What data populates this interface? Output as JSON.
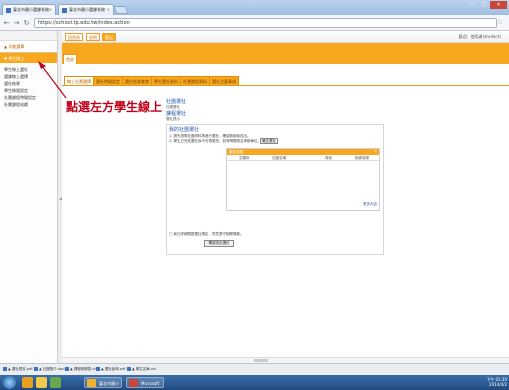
{
  "browser": {
    "tabs": [
      {
        "title": "臺北市國小選課系統"
      },
      {
        "title": "臺北市國小選課系統"
      }
    ],
    "url": "https://school.tp.edu.tw/index.action",
    "window_buttons": [
      "—",
      "□",
      "✕"
    ]
  },
  "sidebar": {
    "header": "▲ 功能選單",
    "active_item": "▼ 學生線上",
    "items": [
      "學生線上選社",
      "選課線上選擇",
      "選社結果",
      "學生帳號設定",
      "社團課程時間設定",
      "社團課程成績"
    ]
  },
  "topnav": {
    "buttons": [
      "回首頁",
      "說明",
      "登出"
    ],
    "user": "歡迎：使用者(student)"
  },
  "breadcrumb": "首頁",
  "content_tabs": [
    {
      "label": "線上社團選擇",
      "active": true
    },
    {
      "label": "選社時間設定",
      "active": false
    },
    {
      "label": "選社結果查詢",
      "active": false
    },
    {
      "label": "學生選社資料",
      "active": false
    },
    {
      "label": "社團課程資料",
      "active": false
    },
    {
      "label": "選社注意事項",
      "active": false
    }
  ],
  "annotation": "點選左方學生線上",
  "links": {
    "link1": "社團選社",
    "link1_sub": "社團選社",
    "link2": "課程選社",
    "link2_sub": "選社提示"
  },
  "box": {
    "title": "我的社團選社",
    "line1": "1. 請先瀏覽社團資料再進行選社，確認無誤後送出。",
    "line2": "2. 學生已完成選社後不可再更改，如有問題請洽承辦單位。",
    "btn": "確定選社",
    "inner_head": "選社志願",
    "close": "✕",
    "columns": [
      "志願序",
      "社團名稱",
      "時段",
      "指導老師"
    ],
    "more": "更多內容",
    "footer": "□ 我已詳細閱讀選社規定，同意遵守相關規範。",
    "btn2": "確認送出選社"
  },
  "downloads": [
    "▲ 選社規定.pdf",
    "▲ 社團簡介.docx",
    "▲ 課程時間表.xls",
    "▲ 選社說明.pdf",
    "▲ 學生名單.xls"
  ],
  "taskbar": {
    "tasks": [
      "臺北市國小",
      "Microsoft"
    ],
    "time": "下午 01:30",
    "date": "2014/4/2"
  },
  "colors": {
    "accent": "#f7a81e",
    "annotation": "#c0001a",
    "link": "#2255aa"
  }
}
